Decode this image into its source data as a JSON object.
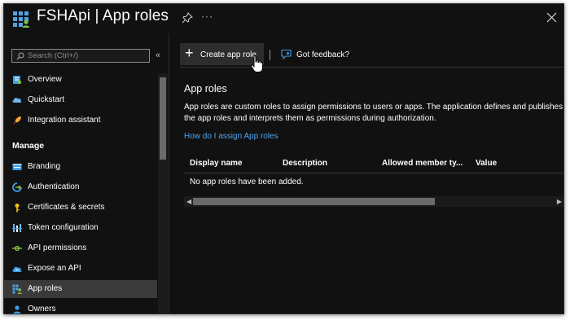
{
  "header": {
    "title": "FSHApi | App roles",
    "more_label": "···"
  },
  "sidebar": {
    "search_placeholder": "Search (Ctrl+/)",
    "collapse_label": "«",
    "items": [
      {
        "label": "Overview",
        "icon": "overview-icon"
      },
      {
        "label": "Quickstart",
        "icon": "quickstart-cloud-icon"
      },
      {
        "label": "Integration assistant",
        "icon": "rocket-icon"
      }
    ],
    "section": "Manage",
    "manage_items": [
      {
        "label": "Branding",
        "icon": "branding-icon"
      },
      {
        "label": "Authentication",
        "icon": "authentication-icon"
      },
      {
        "label": "Certificates & secrets",
        "icon": "key-icon"
      },
      {
        "label": "Token configuration",
        "icon": "token-bars-icon"
      },
      {
        "label": "API permissions",
        "icon": "api-permissions-icon"
      },
      {
        "label": "Expose an API",
        "icon": "cloud-api-icon"
      },
      {
        "label": "App roles",
        "icon": "app-roles-icon",
        "active": true
      },
      {
        "label": "Owners",
        "icon": "owners-icon"
      }
    ]
  },
  "toolbar": {
    "create_label": "Create app role",
    "feedback_label": "Got feedback?"
  },
  "content": {
    "title": "App roles",
    "description": "App roles are custom roles to assign permissions to users or apps. The application defines and publishes the app roles and interprets them as permissions during authorization.",
    "help_link": "How do I assign App roles",
    "table": {
      "columns": [
        "Display name",
        "Description",
        "Allowed member ty...",
        "Value"
      ],
      "empty_message": "No app roles have been added."
    }
  },
  "colors": {
    "background": "#111111",
    "active_item": "#3a3a3a",
    "link": "#4ea5f3",
    "accent": "#3b9fe8"
  }
}
